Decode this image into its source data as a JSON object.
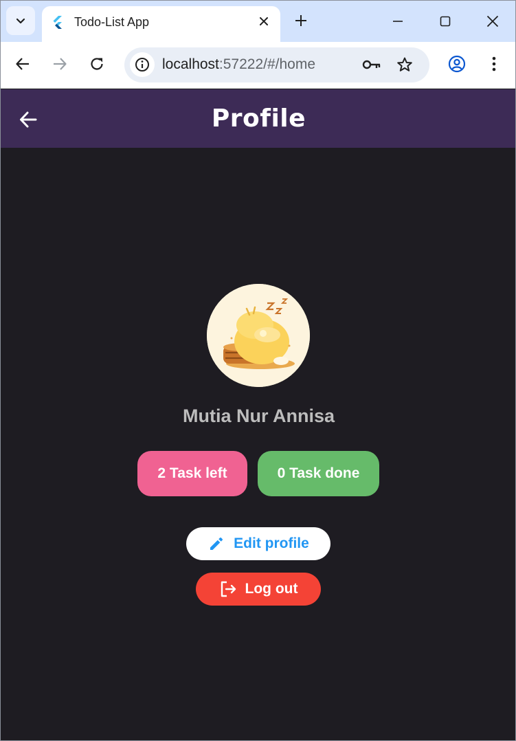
{
  "browser": {
    "tab_title": "Todo-List App",
    "url_host": "localhost",
    "url_path": ":57222/#/home",
    "icons": {
      "tab_search": "chevron-down-icon",
      "favicon": "flutter-icon",
      "tab_close": "close-icon",
      "new_tab": "plus-icon",
      "minimize": "minimize-icon",
      "maximize": "maximize-icon",
      "close": "close-icon",
      "back": "arrow-left-icon",
      "forward": "arrow-right-icon",
      "reload": "reload-icon",
      "site_info": "info-icon",
      "passwords": "key-icon",
      "bookmark": "star-icon",
      "profile": "account-icon",
      "menu": "kebab-menu-icon"
    }
  },
  "appbar": {
    "title": "Profile",
    "background": "#3d2b56"
  },
  "profile": {
    "name": "Mutia Nur Annisa",
    "avatar_icon": "sleeping-duck-avatar"
  },
  "stats": {
    "tasks_left": "2 Task left",
    "tasks_done": "0 Task done",
    "tasks_left_color": "#f06292",
    "tasks_done_color": "#66bb6a"
  },
  "actions": {
    "edit_label": "Edit profile",
    "logout_label": "Log out",
    "edit_color": "#2196f3",
    "logout_color": "#f44336"
  }
}
